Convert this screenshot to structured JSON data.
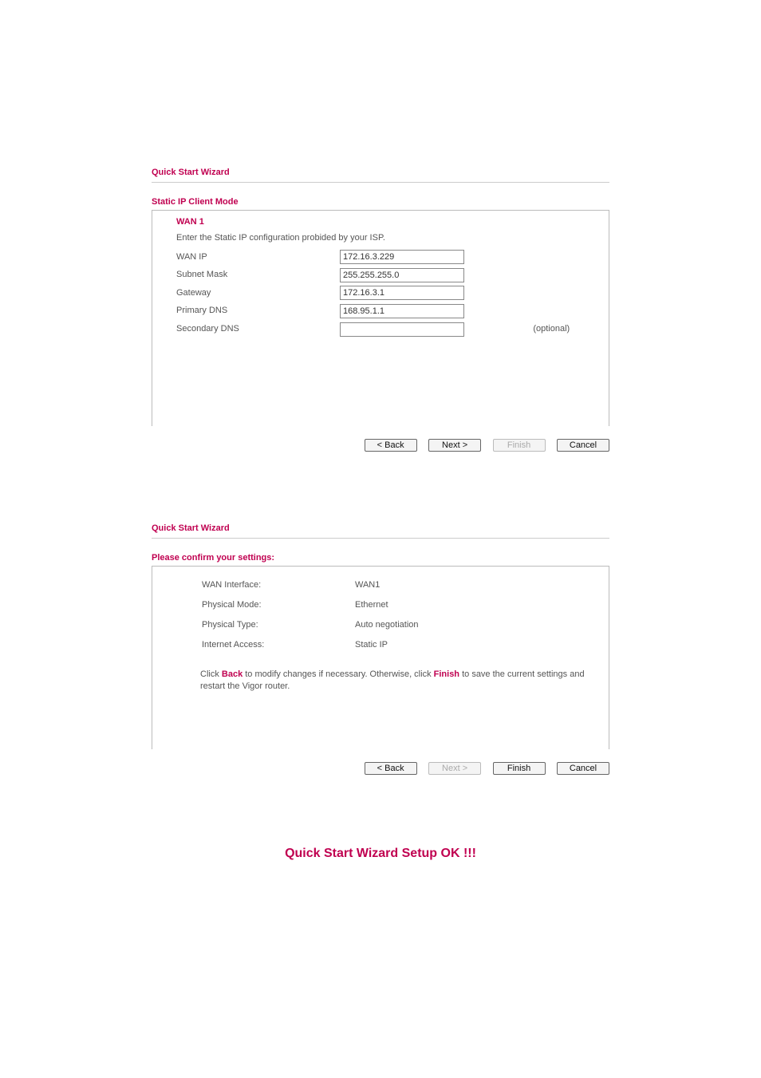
{
  "section1": {
    "title": "Quick Start Wizard",
    "subheading": "Static IP Client Mode",
    "wan_label": "WAN 1",
    "instruction": "Enter the Static IP configuration probided by your ISP.",
    "fields": {
      "wan_ip_label": "WAN IP",
      "wan_ip_value": "172.16.3.229",
      "subnet_label": "Subnet Mask",
      "subnet_value": "255.255.255.0",
      "gateway_label": "Gateway",
      "gateway_value": "172.16.3.1",
      "pdns_label": "Primary DNS",
      "pdns_value": "168.95.1.1",
      "sdns_label": "Secondary DNS",
      "sdns_value": "",
      "optional": "(optional)"
    },
    "buttons": {
      "back": "< Back",
      "next": "Next >",
      "finish": "Finish",
      "cancel": "Cancel"
    }
  },
  "section2": {
    "title": "Quick Start Wizard",
    "subheading": "Please confirm your settings:",
    "rows": {
      "wan_if_label": "WAN Interface:",
      "wan_if_value": "WAN1",
      "pmode_label": "Physical Mode:",
      "pmode_value": "Ethernet",
      "ptype_label": "Physical Type:",
      "ptype_value": "Auto negotiation",
      "iaccess_label": "Internet Access:",
      "iaccess_value": "Static IP"
    },
    "note_pre": "Click ",
    "note_back": "Back",
    "note_mid": " to modify changes if necessary. Otherwise, click ",
    "note_finish": "Finish",
    "note_post": " to save the current settings and restart the Vigor router.",
    "buttons": {
      "back": "< Back",
      "next": "Next >",
      "finish": "Finish",
      "cancel": "Cancel"
    }
  },
  "setup_ok": "Quick Start Wizard Setup OK !!!"
}
